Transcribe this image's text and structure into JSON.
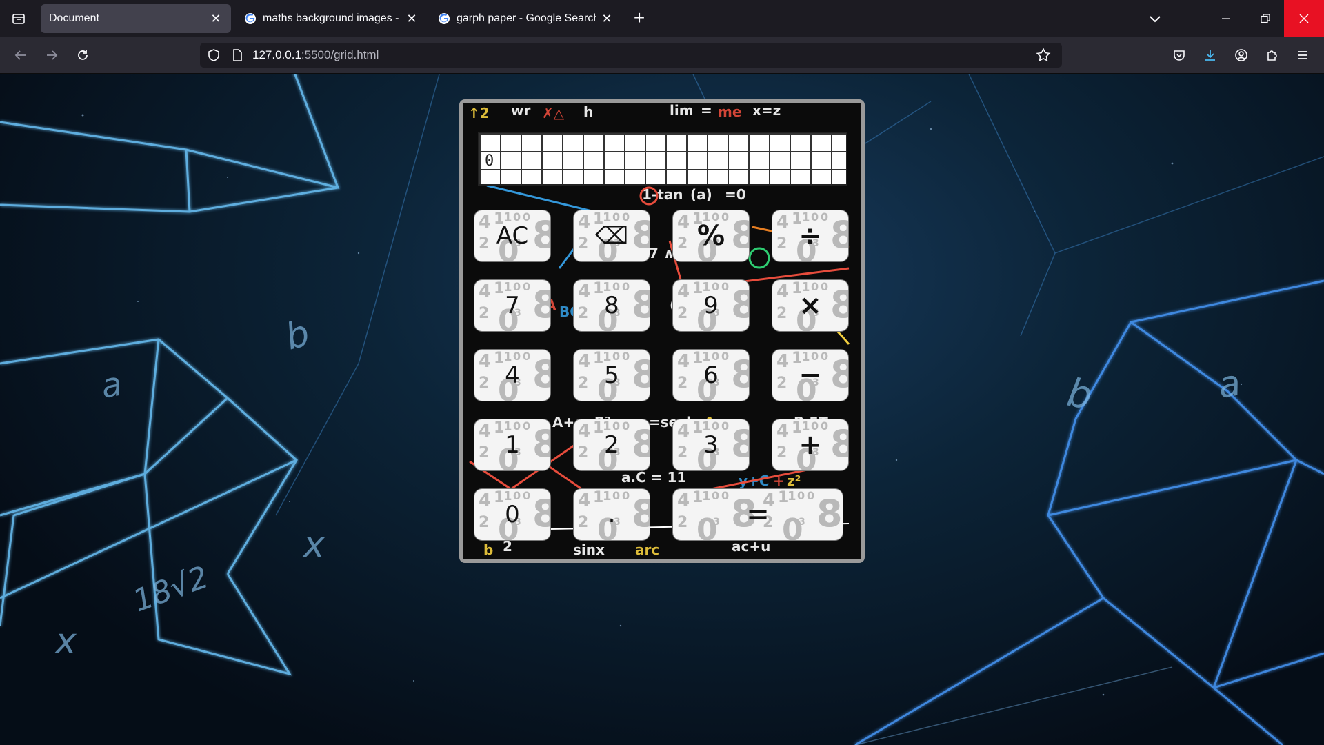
{
  "browser": {
    "tabs": [
      {
        "title": "Document",
        "active": true
      },
      {
        "title": "maths background images - Go",
        "active": false
      },
      {
        "title": "garph paper - Google Search",
        "active": false
      }
    ],
    "new_tab_label": "+",
    "url_host": "127.0.0.1",
    "url_path": ":5500/grid.html"
  },
  "calculator": {
    "display_value": "0",
    "keys": [
      {
        "label": "AC",
        "kind": "function"
      },
      {
        "label": "⌫",
        "kind": "function"
      },
      {
        "label": "%",
        "kind": "operator"
      },
      {
        "label": "÷",
        "kind": "operator"
      },
      {
        "label": "7",
        "kind": "digit"
      },
      {
        "label": "8",
        "kind": "digit"
      },
      {
        "label": "9",
        "kind": "digit"
      },
      {
        "label": "×",
        "kind": "operator"
      },
      {
        "label": "4",
        "kind": "digit"
      },
      {
        "label": "5",
        "kind": "digit"
      },
      {
        "label": "6",
        "kind": "digit"
      },
      {
        "label": "−",
        "kind": "operator"
      },
      {
        "label": "1",
        "kind": "digit"
      },
      {
        "label": "2",
        "kind": "digit"
      },
      {
        "label": "3",
        "kind": "digit"
      },
      {
        "label": "+",
        "kind": "operator"
      },
      {
        "label": "0",
        "kind": "digit"
      },
      {
        "label": ".",
        "kind": "digit"
      },
      {
        "label": "=",
        "kind": "equals"
      }
    ]
  },
  "background_text": [
    "a",
    "b",
    "b",
    "a",
    "x",
    "x",
    "18√2"
  ]
}
